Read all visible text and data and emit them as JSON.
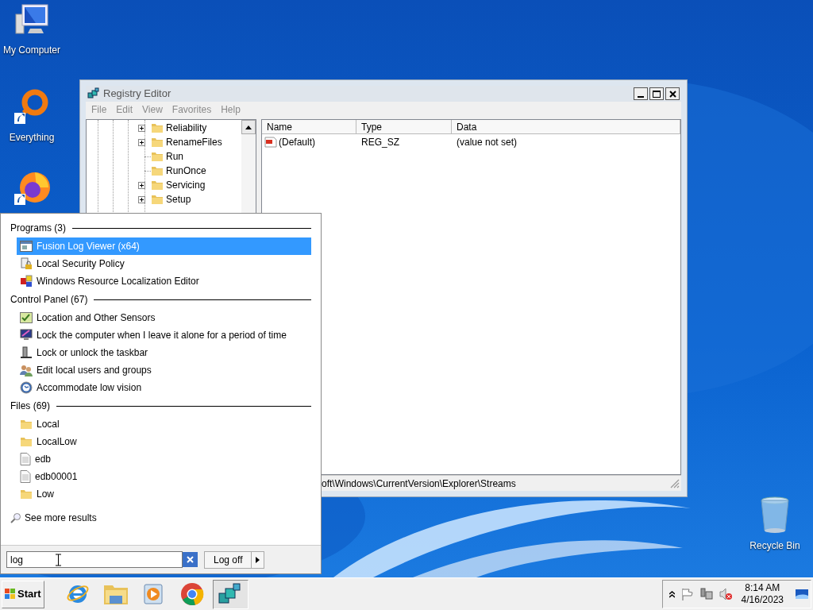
{
  "desktop_icons": [
    {
      "kind": "computer",
      "label": "My Computer"
    },
    {
      "kind": "everything",
      "label": "Everything"
    },
    {
      "kind": "firefox"
    },
    {
      "kind": "recycle",
      "label": "Recycle Bin"
    }
  ],
  "registry_editor": {
    "title": "Registry Editor",
    "focused": false,
    "menu": [
      "File",
      "Edit",
      "View",
      "Favorites",
      "Help"
    ],
    "tree": [
      {
        "label": "Reliability",
        "expandable": true
      },
      {
        "label": "RenameFiles",
        "expandable": true
      },
      {
        "label": "Run",
        "expandable": false
      },
      {
        "label": "RunOnce",
        "expandable": false
      },
      {
        "label": "Servicing",
        "expandable": true
      },
      {
        "label": "Setup",
        "expandable": true
      }
    ],
    "columns": [
      "Name",
      "Type",
      "Data"
    ],
    "rows": [
      {
        "name": "(Default)",
        "type": "REG_SZ",
        "data": "(value not set)"
      }
    ],
    "status_bar": "oft\\Windows\\CurrentVersion\\Explorer\\Streams"
  },
  "start_menu": {
    "sections": [
      {
        "title": "Programs (3)",
        "items": [
          {
            "label": "Fusion Log Viewer (x64)",
            "kind": "app-window",
            "selected": true
          },
          {
            "label": "Local Security Policy",
            "kind": "security",
            "selected": false
          },
          {
            "label": "Windows Resource Localization Editor",
            "kind": "resource",
            "selected": false
          }
        ]
      },
      {
        "title": "Control Panel (67)",
        "items": [
          {
            "label": "Location and Other Sensors",
            "kind": "sensor",
            "selected": false
          },
          {
            "label": "Lock the computer when I leave it alone for a period of time",
            "kind": "monitor",
            "selected": false
          },
          {
            "label": "Lock or unlock the taskbar",
            "kind": "taskbar",
            "selected": false
          },
          {
            "label": "Edit local users and groups",
            "kind": "users",
            "selected": false
          },
          {
            "label": "Accommodate low vision",
            "kind": "accessibility",
            "selected": false
          }
        ]
      },
      {
        "title": "Files (69)",
        "items": [
          {
            "label": "Local",
            "kind": "folder",
            "selected": false
          },
          {
            "label": "LocalLow",
            "kind": "folder",
            "selected": false
          },
          {
            "label": "edb",
            "kind": "document",
            "selected": false
          },
          {
            "label": "edb00001",
            "kind": "document",
            "selected": false
          },
          {
            "label": "Low",
            "kind": "folder",
            "selected": false
          }
        ]
      }
    ],
    "see_more": "See more results",
    "search": {
      "value": "log"
    },
    "power_button": "Log off"
  },
  "taskbar": {
    "start_label": "Start",
    "pinned": [
      {
        "kind": "browser",
        "selected": false
      },
      {
        "kind": "explorer",
        "selected": false
      },
      {
        "kind": "media",
        "selected": false
      },
      {
        "kind": "chrome",
        "selected": false
      },
      {
        "kind": "regedit",
        "selected": true
      }
    ],
    "clock": {
      "time": "8:14 AM",
      "date": "4/16/2023"
    }
  }
}
